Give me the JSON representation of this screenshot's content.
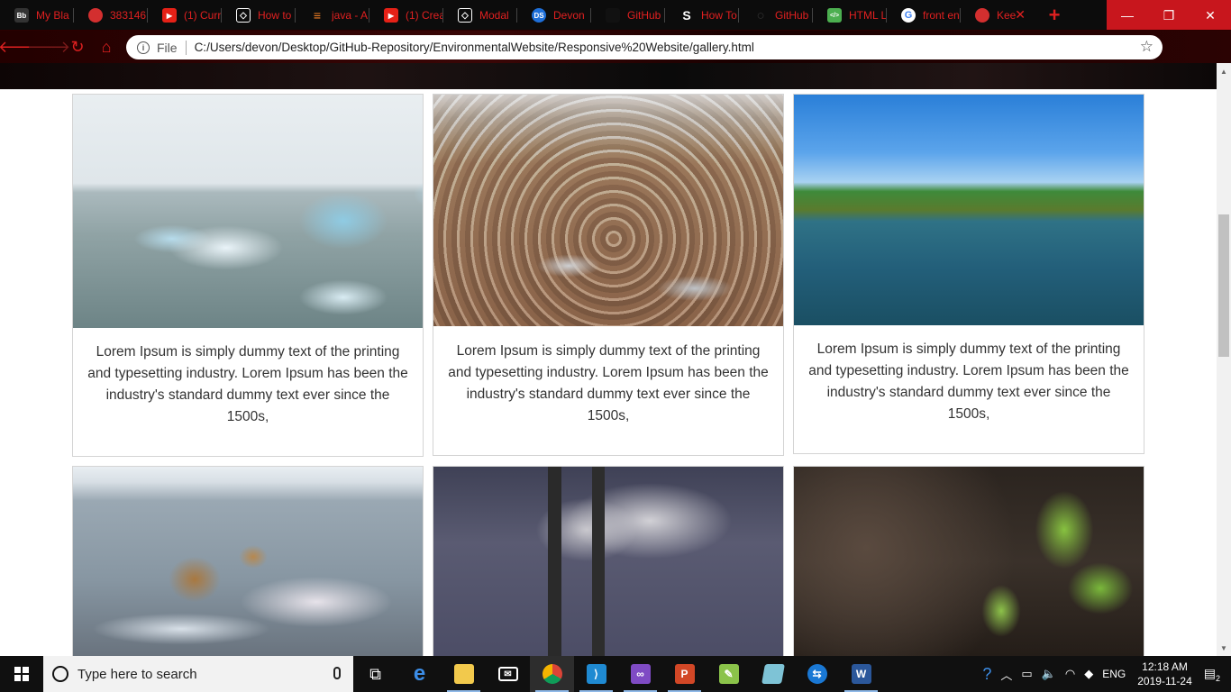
{
  "tabs": [
    {
      "label": "My Bla",
      "icon": "blackboard-icon",
      "color": "#333333",
      "glyph": "Bb"
    },
    {
      "label": "383146",
      "icon": "no-sign-icon",
      "color": "#d32f2f",
      "glyph": ""
    },
    {
      "label": "(1) Curr",
      "icon": "youtube-icon",
      "color": "#e62117",
      "glyph": "▶"
    },
    {
      "label": "How to",
      "icon": "codepen-icon",
      "color": "#ffffff",
      "glyph": "◇"
    },
    {
      "label": "java - A",
      "icon": "stackoverflow-icon",
      "color": "#f48024",
      "glyph": "≡"
    },
    {
      "label": "(1) Crea",
      "icon": "youtube-icon",
      "color": "#e62117",
      "glyph": "▶"
    },
    {
      "label": "Modal",
      "icon": "codepen-icon",
      "color": "#ffffff",
      "glyph": "◇"
    },
    {
      "label": "Devon",
      "icon": "ds-icon",
      "color": "#1e6fd9",
      "glyph": "DS"
    },
    {
      "label": "GitHub",
      "icon": "github-icon",
      "color": "#111111",
      "glyph": ""
    },
    {
      "label": "How To",
      "icon": "s-icon",
      "color": "#111111",
      "glyph": "S"
    },
    {
      "label": "GitHub",
      "icon": "github-icon",
      "color": "#111111",
      "glyph": "○"
    },
    {
      "label": "HTML L",
      "icon": "htmlpreview-icon",
      "color": "#4caf50",
      "glyph": "</>"
    },
    {
      "label": "front en",
      "icon": "google-icon",
      "color": "#ffffff",
      "glyph": "G"
    },
    {
      "label": "Kee",
      "icon": "no-sign-icon",
      "color": "#d32f2f",
      "glyph": ""
    }
  ],
  "window_controls": {
    "minimize": "—",
    "maximize": "❐",
    "close": "✕"
  },
  "toolbar": {
    "file_label": "File",
    "url": "C:/Users/devon/Desktop/GitHub-Repository/EnvironmentalWebsite/Responsive%20Website/gallery.html"
  },
  "gallery": {
    "cards": [
      {
        "image": "icebergs",
        "caption": "Lorem Ipsum is simply dummy text of the printing and typesetting industry. Lorem Ipsum has been the industry's standard dummy text ever since the 1500s,"
      },
      {
        "image": "plastic-beach",
        "caption": "Lorem Ipsum is simply dummy text of the printing and typesetting industry. Lorem Ipsum has been the industry's standard dummy text ever since the 1500s,"
      },
      {
        "image": "lake",
        "caption": "Lorem Ipsum is simply dummy text of the printing and typesetting industry. Lorem Ipsum has been the industry's standard dummy text ever since the 1500s,"
      },
      {
        "image": "polar-bear"
      },
      {
        "image": "smokestacks"
      },
      {
        "image": "sprout"
      }
    ]
  },
  "taskbar": {
    "search_placeholder": "Type here to search",
    "apps": [
      "task-view-icon",
      "edge-icon",
      "file-explorer-icon",
      "mail-icon",
      "chrome-icon",
      "vscode-icon",
      "visual-studio-icon",
      "powerpoint-icon",
      "notepadpp-icon",
      "app-icon",
      "teamviewer-icon",
      "word-icon"
    ],
    "tray": {
      "language": "ENG",
      "time": "12:18 AM",
      "date": "2019-11-24",
      "notifications": "2"
    }
  }
}
